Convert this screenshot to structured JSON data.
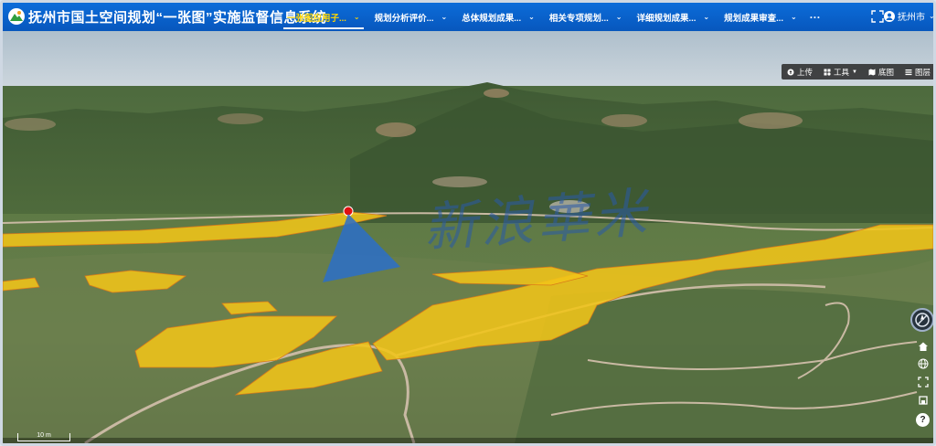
{
  "header": {
    "title": "抚州市国土空间规划“一张图”实施监督信息系统",
    "tabs": [
      {
        "label": "一张图应用子...",
        "active": true
      },
      {
        "label": "规划分析评价...",
        "active": false
      },
      {
        "label": "总体规划成果...",
        "active": false
      },
      {
        "label": "相关专项规划...",
        "active": false
      },
      {
        "label": "详细规划成果...",
        "active": false
      },
      {
        "label": "规划成果审查...",
        "active": false
      }
    ],
    "more_label": "···",
    "user_region": "抚州市",
    "accent_color": "#0b66d0",
    "active_tab_color": "#ffd600"
  },
  "map_toolbar": {
    "upload_label": "上传",
    "tools_label": "工具",
    "basemap_label": "底图",
    "layers_label": "图层"
  },
  "map": {
    "scale_label": "10 m",
    "highlight_color": "#f0c419"
  },
  "watermark": {
    "text": "新浪華米"
  },
  "icons": {
    "logo": "mountain-logo-icon",
    "fullscreen": "fullscreen-icon",
    "user": "user-icon",
    "upload": "upload-icon",
    "tools": "tools-icon",
    "basemap": "map-icon",
    "layers": "layers-icon",
    "compass": "compass-icon",
    "home": "home-icon",
    "globe": "globe-icon",
    "zoom-extent": "expand-icon",
    "view-2d3d": "view-toggle-icon",
    "help": "help-icon"
  }
}
